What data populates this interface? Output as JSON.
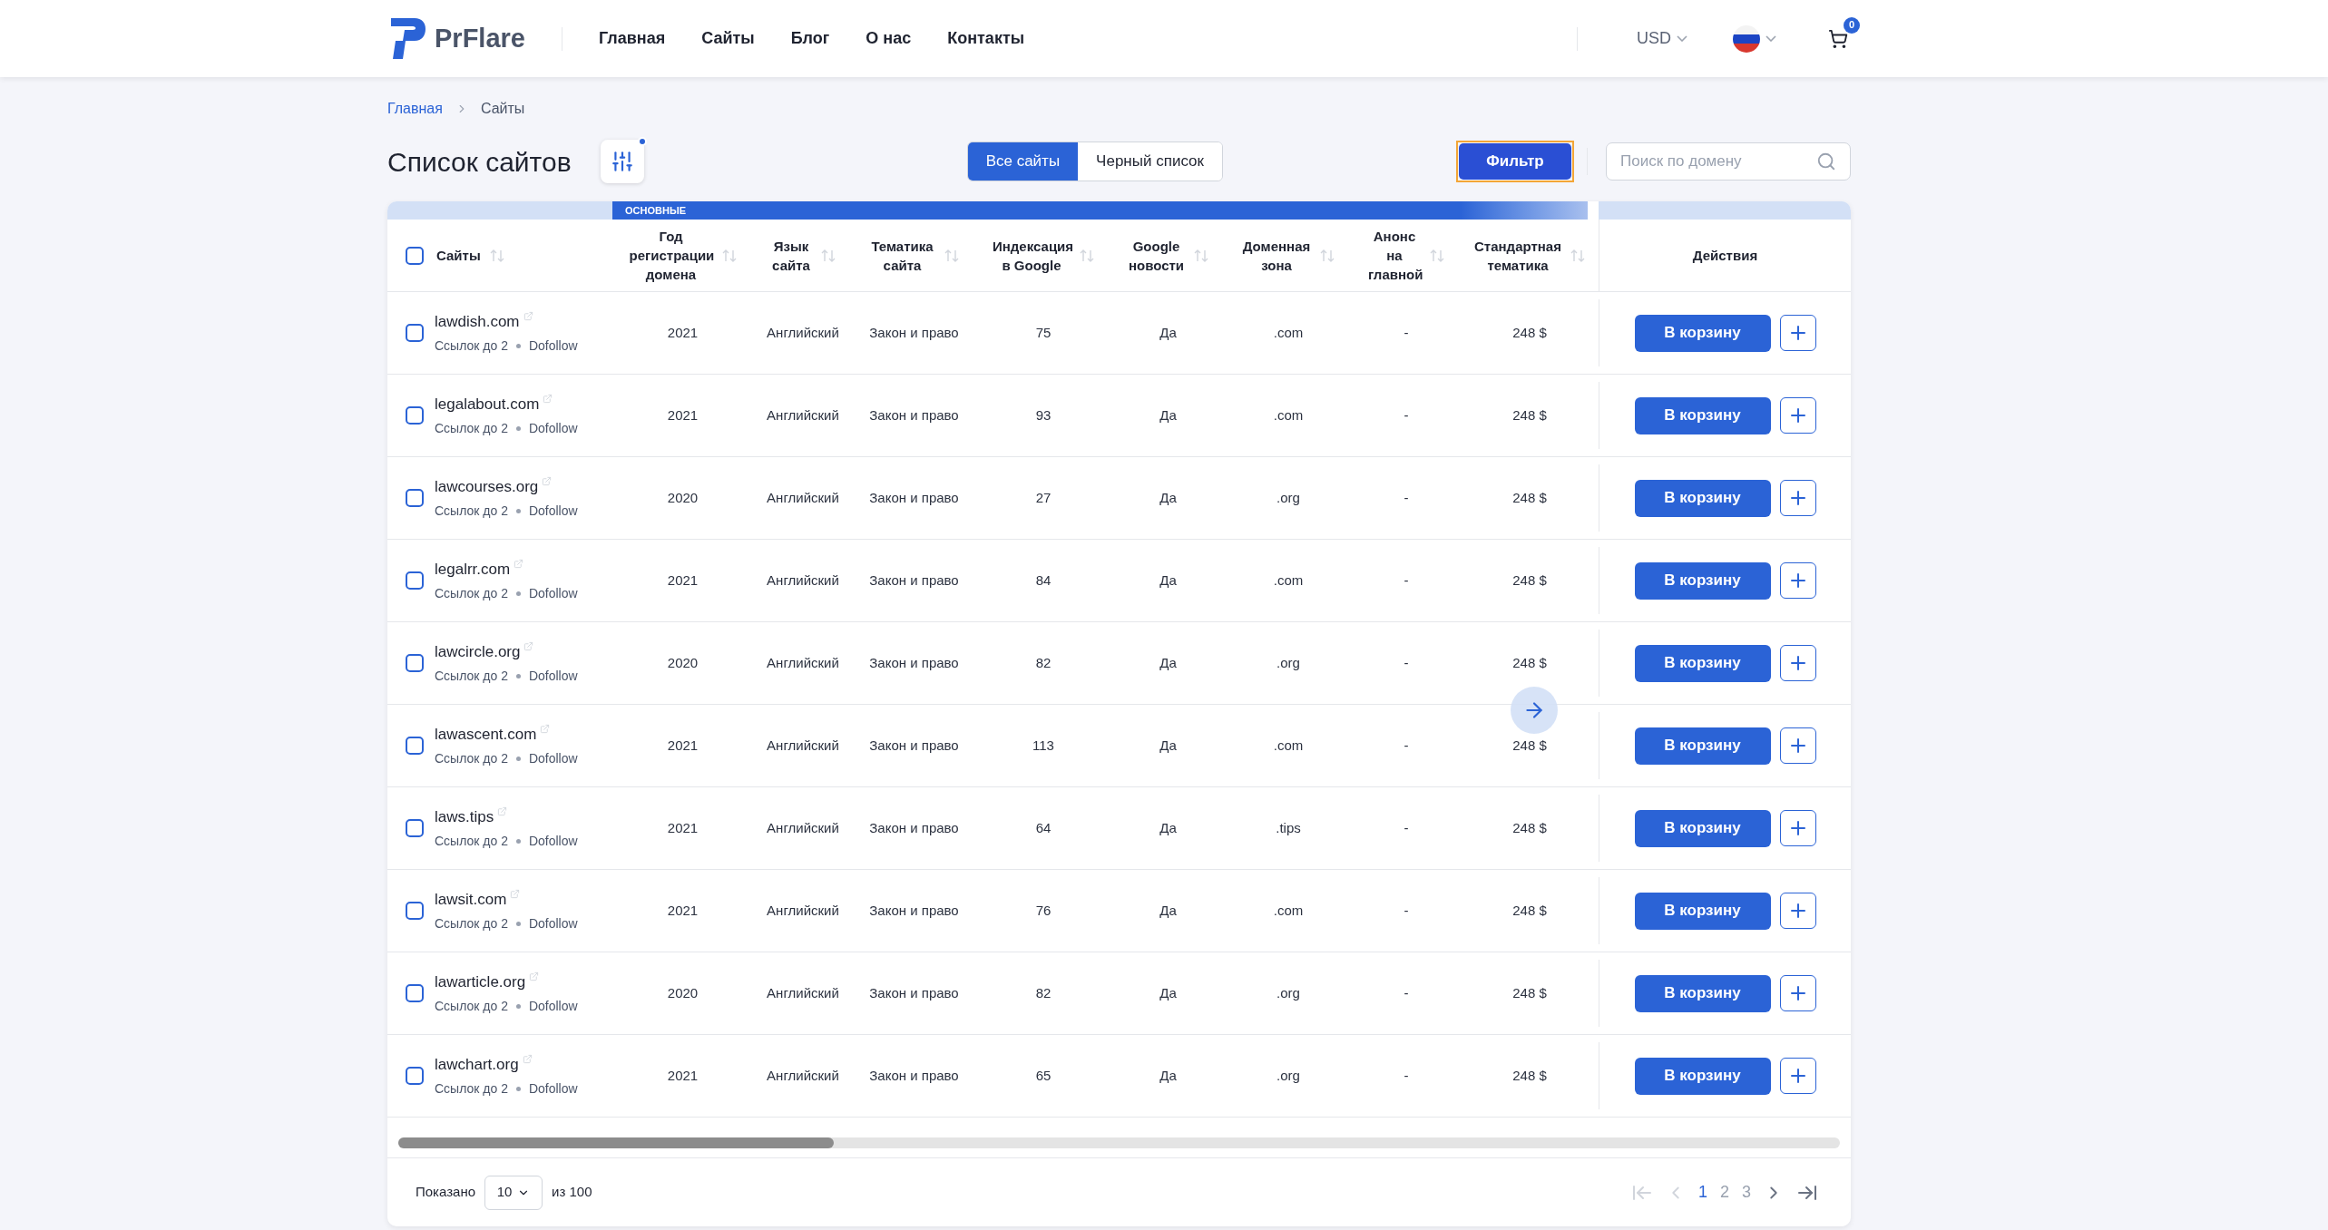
{
  "header": {
    "logo": "PrFlare",
    "nav": [
      {
        "label": "Главная"
      },
      {
        "label": "Сайты"
      },
      {
        "label": "Блог"
      },
      {
        "label": "О нас"
      },
      {
        "label": "Контакты"
      }
    ],
    "currency": "USD",
    "cart_count": "0"
  },
  "breadcrumb": [
    {
      "label": "Главная",
      "kind": "link"
    },
    {
      "label": "Сайты",
      "kind": "current"
    }
  ],
  "title": "Список сайтов",
  "tabs": [
    {
      "label": "Все сайты",
      "selected": true
    },
    {
      "label": "Черный список",
      "selected": false
    }
  ],
  "filter_button": "Фильтр",
  "search": {
    "placeholder": "Поиск по домену"
  },
  "table": {
    "group_label": "ОСНОВНЫЕ",
    "select_all_checked": false,
    "columns": [
      {
        "label": "Сайты",
        "sortable": true
      },
      {
        "label": "Год регистрации домена",
        "sortable": true
      },
      {
        "label": "Язык сайта",
        "sortable": true
      },
      {
        "label": "Тематика сайта",
        "sortable": true
      },
      {
        "label": "Индексация в Google",
        "sortable": true
      },
      {
        "label": "Google новости",
        "sortable": true
      },
      {
        "label": "Доменная зона",
        "sortable": true
      },
      {
        "label": "Анонс на главной",
        "sortable": true
      },
      {
        "label": "Стандартная тематика",
        "sortable": true
      },
      {
        "label": "Действия",
        "sortable": false
      }
    ],
    "rows": [
      {
        "checked": false,
        "site": "lawdish.com",
        "links": "Ссылок до 2",
        "follow": "Dofollow",
        "year": "2021",
        "language": "Английский",
        "topic": "Закон и право",
        "index": "75",
        "google_news": "Да",
        "zone": ".com",
        "announce": "-",
        "price": "248 $",
        "action": "В корзину"
      },
      {
        "checked": false,
        "site": "legalabout.com",
        "links": "Ссылок до 2",
        "follow": "Dofollow",
        "year": "2021",
        "language": "Английский",
        "topic": "Закон и право",
        "index": "93",
        "google_news": "Да",
        "zone": ".com",
        "announce": "-",
        "price": "248 $",
        "action": "В корзину"
      },
      {
        "checked": false,
        "site": "lawcourses.org",
        "links": "Ссылок до 2",
        "follow": "Dofollow",
        "year": "2020",
        "language": "Английский",
        "topic": "Закон и право",
        "index": "27",
        "google_news": "Да",
        "zone": ".org",
        "announce": "-",
        "price": "248 $",
        "action": "В корзину"
      },
      {
        "checked": false,
        "site": "legalrr.com",
        "links": "Ссылок до 2",
        "follow": "Dofollow",
        "year": "2021",
        "language": "Английский",
        "topic": "Закон и право",
        "index": "84",
        "google_news": "Да",
        "zone": ".com",
        "announce": "-",
        "price": "248 $",
        "action": "В корзину"
      },
      {
        "checked": false,
        "site": "lawcircle.org",
        "links": "Ссылок до 2",
        "follow": "Dofollow",
        "year": "2020",
        "language": "Английский",
        "topic": "Закон и право",
        "index": "82",
        "google_news": "Да",
        "zone": ".org",
        "announce": "-",
        "price": "248 $",
        "action": "В корзину"
      },
      {
        "checked": false,
        "site": "lawascent.com",
        "links": "Ссылок до 2",
        "follow": "Dofollow",
        "year": "2021",
        "language": "Английский",
        "topic": "Закон и право",
        "index": "113",
        "google_news": "Да",
        "zone": ".com",
        "announce": "-",
        "price": "248 $",
        "action": "В корзину"
      },
      {
        "checked": false,
        "site": "laws.tips",
        "links": "Ссылок до 2",
        "follow": "Dofollow",
        "year": "2021",
        "language": "Английский",
        "topic": "Закон и право",
        "index": "64",
        "google_news": "Да",
        "zone": ".tips",
        "announce": "-",
        "price": "248 $",
        "action": "В корзину"
      },
      {
        "checked": false,
        "site": "lawsit.com",
        "links": "Ссылок до 2",
        "follow": "Dofollow",
        "year": "2021",
        "language": "Английский",
        "topic": "Закон и право",
        "index": "76",
        "google_news": "Да",
        "zone": ".com",
        "announce": "-",
        "price": "248 $",
        "action": "В корзину"
      },
      {
        "checked": false,
        "site": "lawarticle.org",
        "links": "Ссылок до 2",
        "follow": "Dofollow",
        "year": "2020",
        "language": "Английский",
        "topic": "Закон и право",
        "index": "82",
        "google_news": "Да",
        "zone": ".org",
        "announce": "-",
        "price": "248 $",
        "action": "В корзину"
      },
      {
        "checked": false,
        "site": "lawchart.org",
        "links": "Ссылок до 2",
        "follow": "Dofollow",
        "year": "2021",
        "language": "Английский",
        "topic": "Закон и право",
        "index": "65",
        "google_news": "Да",
        "zone": ".org",
        "announce": "-",
        "price": "248 $",
        "action": "В корзину"
      }
    ]
  },
  "footer": {
    "shown_label": "Показано",
    "page_size": "10",
    "total": "из 100",
    "pages": [
      {
        "label": "1",
        "selected": true
      },
      {
        "label": "2",
        "selected": false
      },
      {
        "label": "3",
        "selected": false
      }
    ]
  }
}
